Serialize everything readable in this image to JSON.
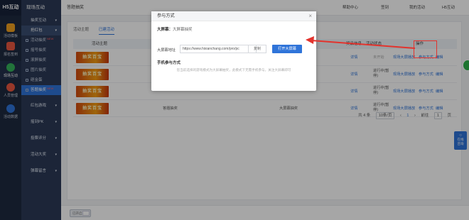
{
  "app": {
    "logo": "H5互动"
  },
  "rail": [
    {
      "label": "活动模板",
      "color": "#f0a020"
    },
    {
      "label": "报名签到",
      "color": "#e8573f"
    },
    {
      "label": "现场互动",
      "color": "#35b35b"
    },
    {
      "label": "人员管理",
      "color": "#e8573f"
    },
    {
      "label": "活动数据",
      "color": "#2f74d9"
    }
  ],
  "subnav": {
    "head": "现场互动",
    "items": [
      {
        "label": "抽奖互动",
        "type": "group"
      },
      {
        "label": "抢红包",
        "type": "group"
      },
      {
        "label": "活动抽奖",
        "new": "NEW"
      },
      {
        "label": "摇号抽奖"
      },
      {
        "label": "滚屏抽奖"
      },
      {
        "label": "图片抽奖"
      },
      {
        "label": "砸金蛋"
      },
      {
        "label": "答题抽奖",
        "new": "NEW",
        "active": true
      }
    ],
    "lower": [
      "红包游戏",
      "摇到PK",
      "投票评分",
      "活动大奖",
      "弹幕留言"
    ]
  },
  "topbar": {
    "crumb": "答题抽奖",
    "help": "帮助中心",
    "sign": "签到",
    "my_activity": "我的活动",
    "user": "H5互动"
  },
  "tabs": [
    "活动主题",
    "已建活动"
  ],
  "table": {
    "headers": [
      "活动主题",
      "奖品信息",
      "活动状态",
      "操作"
    ],
    "rows": [
      {
        "thumb": "抽奖百宝",
        "prize": "详情",
        "status": "未开始",
        "actions": [
          "现场大屏播放",
          "参与方式",
          "编辑",
          "更多"
        ]
      },
      {
        "thumb": "抽奖百宝",
        "prize": "详情",
        "status": "进行中(暂停)",
        "actions": [
          "现场大屏播放",
          "参与方式",
          "编辑",
          "更多"
        ]
      },
      {
        "thumb": "抽奖百宝",
        "prize": "详情",
        "status": "进行中(暂停)",
        "actions": [
          "现场大屏播放",
          "参与方式",
          "编辑",
          "更多"
        ]
      },
      {
        "thumb": "抽奖百宝",
        "title": "答题抽奖",
        "mode": "大屏幕抽奖",
        "prize": "详情",
        "status": "进行中(暂停)",
        "actions": [
          "现场大屏播放",
          "参与方式",
          "编辑",
          "更多"
        ]
      }
    ]
  },
  "pager": {
    "total": "共 4 条",
    "size": "10条/页",
    "prev": "‹",
    "page": "1",
    "next": "›",
    "goto": "前往",
    "page_input": "1",
    "unit": "页"
  },
  "float_btn": "在线咨询",
  "footer": {
    "toggle": "已开启"
  },
  "modal": {
    "title": "参与方式",
    "close": "×",
    "screen_section": "大屏幕：",
    "screen_section_sub": "大屏幕抽奖",
    "url_label": "大屏幕地址",
    "url_value": "https://www.hixianchang.com/pro/pc",
    "copy": "复制",
    "open": "打开大屏幕",
    "mobile_section": "手机参与方式",
    "note": "您当前选择的游戏模式为大屏幕抽奖，此模式下无需手机参与，关注大屏幕即可"
  },
  "colors": {
    "accent": "#2f74d9",
    "annotation": "#e3332d"
  }
}
